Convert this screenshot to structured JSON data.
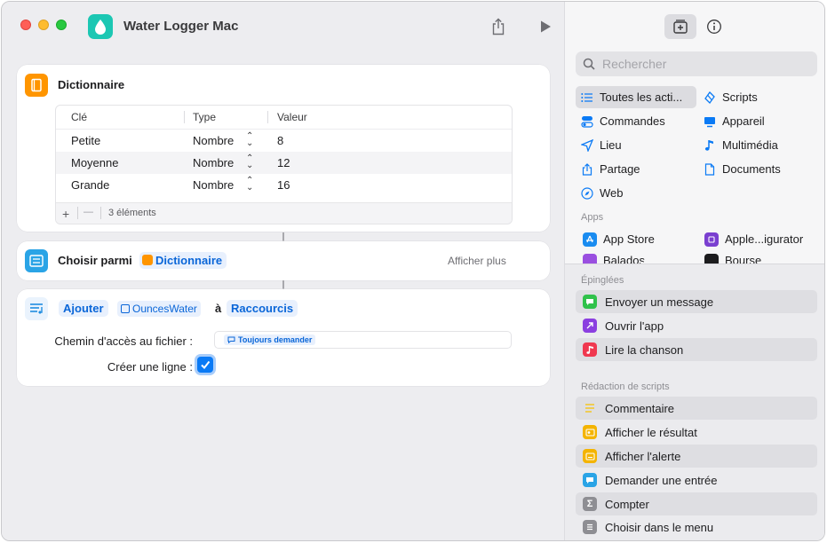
{
  "window": {
    "title": "Water Logger Mac"
  },
  "colors": {
    "accent": "#0a7af5",
    "app_icon": "#1cc7b3",
    "dict_icon": "#ff9500",
    "choose_icon": "#2aa4e6",
    "add_icon": "#1f8de0"
  },
  "editor": {
    "dictionary_action": {
      "title": "Dictionnaire",
      "columns": [
        "Clé",
        "Type",
        "Valeur"
      ],
      "rows": [
        {
          "key": "Petite",
          "type": "Nombre",
          "value": "8"
        },
        {
          "key": "Moyenne",
          "type": "Nombre",
          "value": "12"
        },
        {
          "key": "Grande",
          "type": "Nombre",
          "value": "16"
        }
      ],
      "add_button": "+",
      "remove_button": "—",
      "count_label": "3 éléments"
    },
    "choose_action": {
      "title": "Choisir parmi",
      "token": "Dictionnaire",
      "show_more": "Afficher plus"
    },
    "append_action": {
      "verb": "Ajouter",
      "variable": "OuncesWater",
      "preposition": "à",
      "target": "Raccourcis",
      "path_label": "Chemin d'accès au fichier :",
      "path_token": "Toujours demander",
      "newline_label": "Créer une ligne :",
      "newline_checked": true
    }
  },
  "sidebar": {
    "search_placeholder": "Rechercher",
    "categories": [
      {
        "label": "Toutes les acti...",
        "icon": "list-icon",
        "selected": true
      },
      {
        "label": "Scripts",
        "icon": "scripts-icon"
      },
      {
        "label": "Commandes",
        "icon": "toggle-icon"
      },
      {
        "label": "Appareil",
        "icon": "display-icon"
      },
      {
        "label": "Lieu",
        "icon": "location-icon"
      },
      {
        "label": "Multimédia",
        "icon": "music-note-icon"
      },
      {
        "label": "Partage",
        "icon": "share-icon"
      },
      {
        "label": "Documents",
        "icon": "document-icon"
      },
      {
        "label": "Web",
        "icon": "compass-icon"
      }
    ],
    "apps_label": "Apps",
    "apps": [
      {
        "label": "App Store",
        "icon": "app-store-icon",
        "color": "#1a8cf0"
      },
      {
        "label": "Apple...igurator",
        "icon": "configurator-icon",
        "color": "#7a3fd0"
      },
      {
        "label": "Balados",
        "icon": "podcasts-icon",
        "color": "#9a4fe0"
      },
      {
        "label": "Bourse",
        "icon": "stocks-icon",
        "color": "#1c1c1e"
      }
    ],
    "pinned_label": "Épinglées",
    "pinned": [
      {
        "label": "Envoyer un message",
        "icon": "messages-icon",
        "color": "#30c24b"
      },
      {
        "label": "Ouvrir l'app",
        "icon": "open-app-icon",
        "color": "#8b3fe0"
      },
      {
        "label": "Lire la chanson",
        "icon": "music-icon",
        "color": "#f0384f"
      }
    ],
    "scripting_label": "Rédaction de scripts",
    "scripting": [
      {
        "label": "Commentaire",
        "icon": "comment-icon",
        "color": "#f5d44a"
      },
      {
        "label": "Afficher le résultat",
        "icon": "show-result-icon",
        "color": "#f4b400"
      },
      {
        "label": "Afficher l'alerte",
        "icon": "alert-icon",
        "color": "#f4b400"
      },
      {
        "label": "Demander une entrée",
        "icon": "ask-input-icon",
        "color": "#2aa4e6"
      },
      {
        "label": "Compter",
        "icon": "count-icon",
        "color": "#8e8e93"
      },
      {
        "label": "Choisir dans le menu",
        "icon": "menu-icon",
        "color": "#8e8e93"
      }
    ]
  }
}
